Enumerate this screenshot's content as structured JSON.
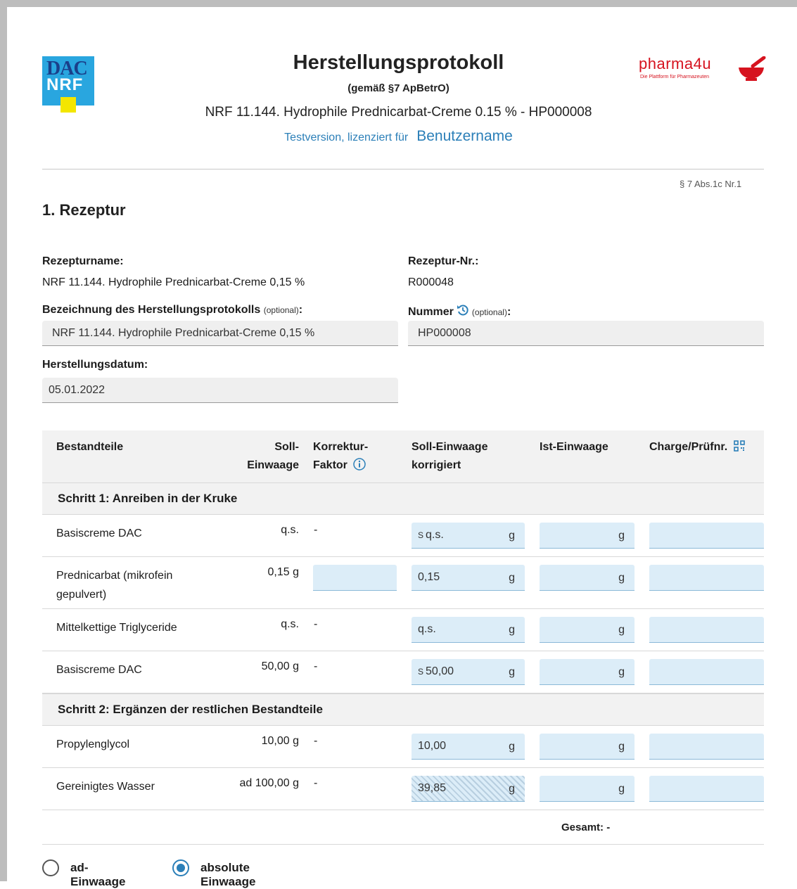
{
  "header": {
    "logo_left_line1": "DAC",
    "logo_left_line2": "NRF",
    "title": "Herstellungsprotokoll",
    "subtitle": "(gemäß §7 ApBetrO)",
    "recipe_line": "NRF 11.144. Hydrophile Prednicarbat-Creme 0.15 % - HP000008",
    "license_text": "Testversion, lizenziert für",
    "license_user": "Benutzername",
    "brand_logo_word": "pharma4u",
    "brand_logo_tagline": "Die Plattform für Pharmazeuten",
    "brand_color": "#d6131f",
    "accent_color": "#2b7fb8"
  },
  "section": {
    "paragraph_ref": "§ 7 Abs.1c Nr.1",
    "heading": "1. Rezeptur"
  },
  "form": {
    "rezepturname_label": "Rezepturname:",
    "rezepturname_value": "NRF 11.144. Hydrophile Prednicarbat-Creme 0,15 %",
    "rezeptur_nr_label": "Rezeptur-Nr.:",
    "rezeptur_nr_value": "R000048",
    "bezeichnung_label": "Bezeichnung des Herstellungsprotokolls",
    "optional_tag": "(optional)",
    "label_colon": ":",
    "bezeichnung_value": "NRF 11.144. Hydrophile Prednicarbat-Creme 0,15 %",
    "nummer_label": "Nummer",
    "nummer_value": "HP000008",
    "datum_label": "Herstellungsdatum:",
    "datum_value": "05.01.2022"
  },
  "table": {
    "headers": {
      "bestandteile": "Bestandteile",
      "soll_1": "Soll-",
      "soll_2": "Einwaage",
      "korr_1": "Korrektur-",
      "korr_2": "Faktor",
      "soll_korr_1": "Soll-Einwaage",
      "soll_korr_2": "korrigiert",
      "ist": "Ist-Einwaage",
      "charge": "Charge/Prüfnr."
    },
    "steps": [
      {
        "title": "Schritt 1: Anreiben in der Kruke",
        "rows": [
          {
            "name": "Basiscreme DAC",
            "soll": "q.s.",
            "korr": "-",
            "soll_korr_prefix": "S",
            "soll_korr": "q.s.",
            "unit": "g",
            "ist_unit": "g"
          },
          {
            "name": "Prednicarbat (mikrofein gepulvert)",
            "soll": "0,15 g",
            "korr": "",
            "soll_korr_prefix": "",
            "soll_korr": "0,15",
            "unit": "g",
            "ist_unit": "g"
          },
          {
            "name": "Mittelkettige Triglyceride",
            "soll": "q.s.",
            "korr": "-",
            "soll_korr_prefix": "",
            "soll_korr": "q.s.",
            "unit": "g",
            "ist_unit": "g"
          },
          {
            "name": "Basiscreme DAC",
            "soll": "50,00 g",
            "korr": "-",
            "soll_korr_prefix": "S",
            "soll_korr": "50,00",
            "unit": "g",
            "ist_unit": "g"
          }
        ]
      },
      {
        "title": "Schritt 2: Ergänzen der restlichen Bestandteile",
        "rows": [
          {
            "name": "Propylenglycol",
            "soll": "10,00 g",
            "korr": "-",
            "soll_korr_prefix": "",
            "soll_korr": "10,00",
            "unit": "g",
            "ist_unit": "g"
          },
          {
            "name": "Gereinigtes Wasser",
            "soll": "ad 100,00 g",
            "korr": "-",
            "soll_korr_prefix": "",
            "soll_korr": "39,85",
            "unit": "g",
            "ist_unit": "g"
          }
        ]
      }
    ],
    "gesamt": "Gesamt: -"
  },
  "mode": {
    "options": [
      "ad-Einwaage",
      "absolute Einwaage"
    ],
    "selected": "absolute Einwaage"
  }
}
